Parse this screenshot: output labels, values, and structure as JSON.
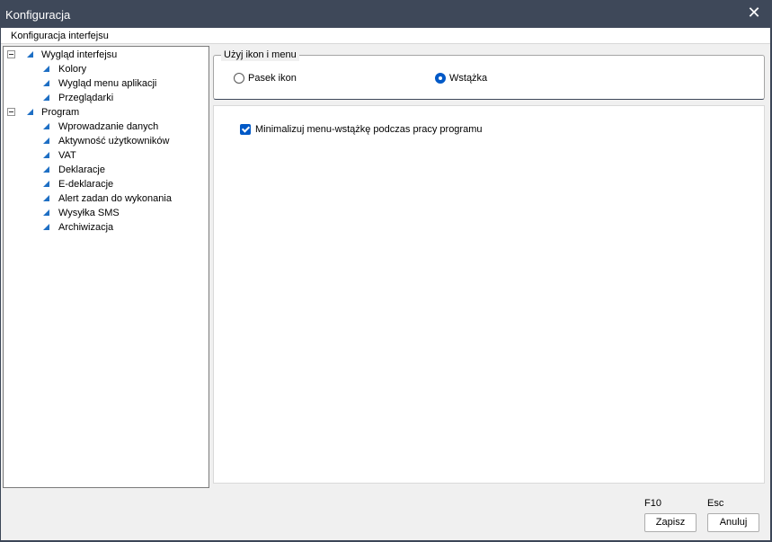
{
  "window": {
    "title": "Konfiguracja",
    "close_glyph": "✕"
  },
  "tabs": [
    {
      "label": "Konfiguracja interfejsu"
    }
  ],
  "tree": {
    "group1": {
      "label": "Wygląd interfejsu",
      "children": [
        "Kolory",
        "Wygląd menu aplikacji",
        "Przeglądarki"
      ]
    },
    "group2": {
      "label": "Program",
      "children": [
        "Wprowadzanie danych",
        "Aktywność użytkowników",
        "VAT",
        "Deklaracje",
        "E-deklaracje",
        "Alert zadan do wykonania",
        "Wysyłka SMS",
        "Archiwizacja"
      ]
    }
  },
  "icon_group": {
    "legend": "Użyj ikon i menu",
    "options": [
      {
        "label": "Pasek ikon",
        "selected": false
      },
      {
        "label": "Wstążka",
        "selected": true
      }
    ]
  },
  "options": {
    "minimize_ribbon": {
      "label": "Minimalizuj menu-wstążkę podczas pracy programu",
      "checked": true
    }
  },
  "footer": {
    "save": {
      "shortcut": "F10",
      "label": "Zapisz"
    },
    "cancel": {
      "shortcut": "Esc",
      "label": "Anuluj"
    }
  },
  "colors": {
    "titlebar": "#3e4859",
    "accent": "#0059c7",
    "tree_icon": "#1e6fc4"
  }
}
